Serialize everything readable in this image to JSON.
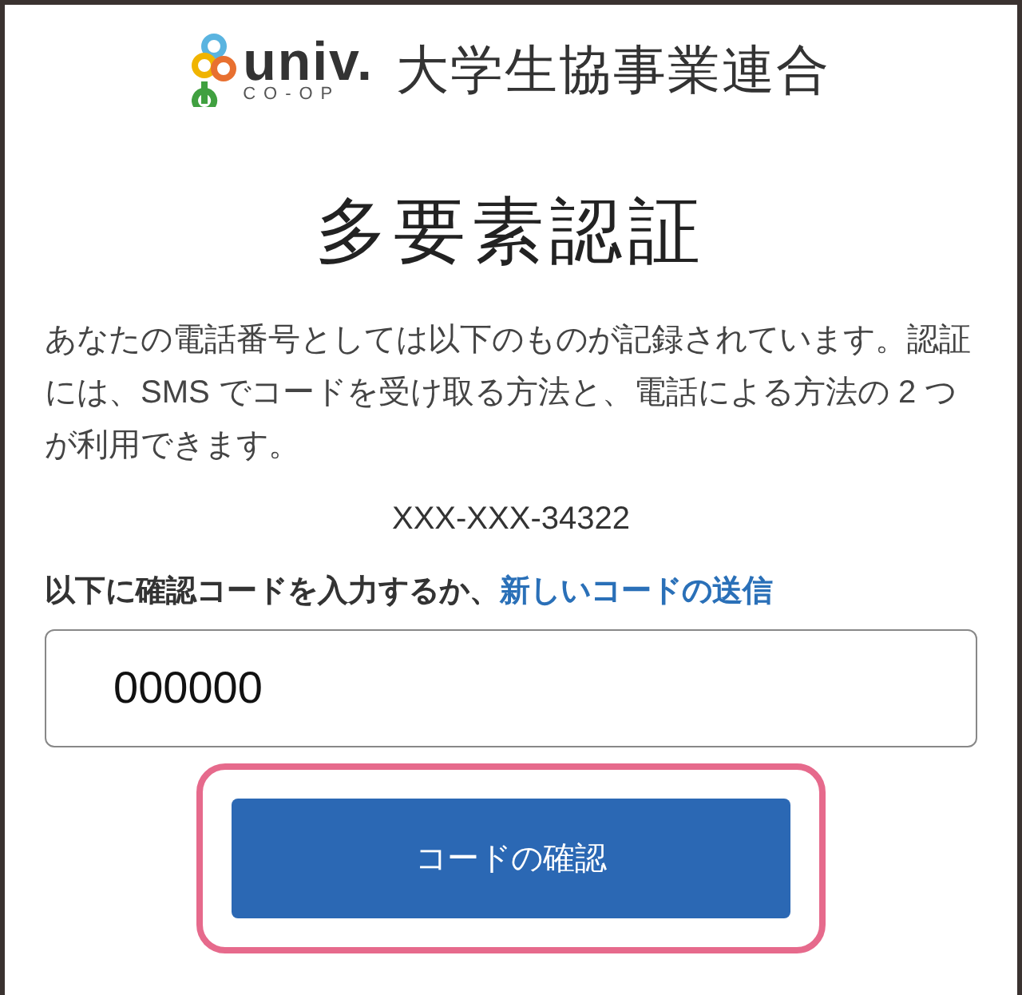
{
  "logo": {
    "wordmark": "univ.",
    "subtitle": "CO-OP",
    "organization": "大学生協事業連合"
  },
  "title": "多要素認証",
  "description": "あなたの電話番号としては以下のものが記録されています。認証には、SMS でコードを受け取る方法と、電話による方法の 2 つが利用できます。",
  "phone": "XXX-XXX-34322",
  "prompt": {
    "text": "以下に確認コードを入力するか、",
    "link": "新しいコードの送信"
  },
  "code_field": {
    "value": "000000"
  },
  "verify_button": {
    "label": "コードの確認",
    "highlighted": true
  }
}
